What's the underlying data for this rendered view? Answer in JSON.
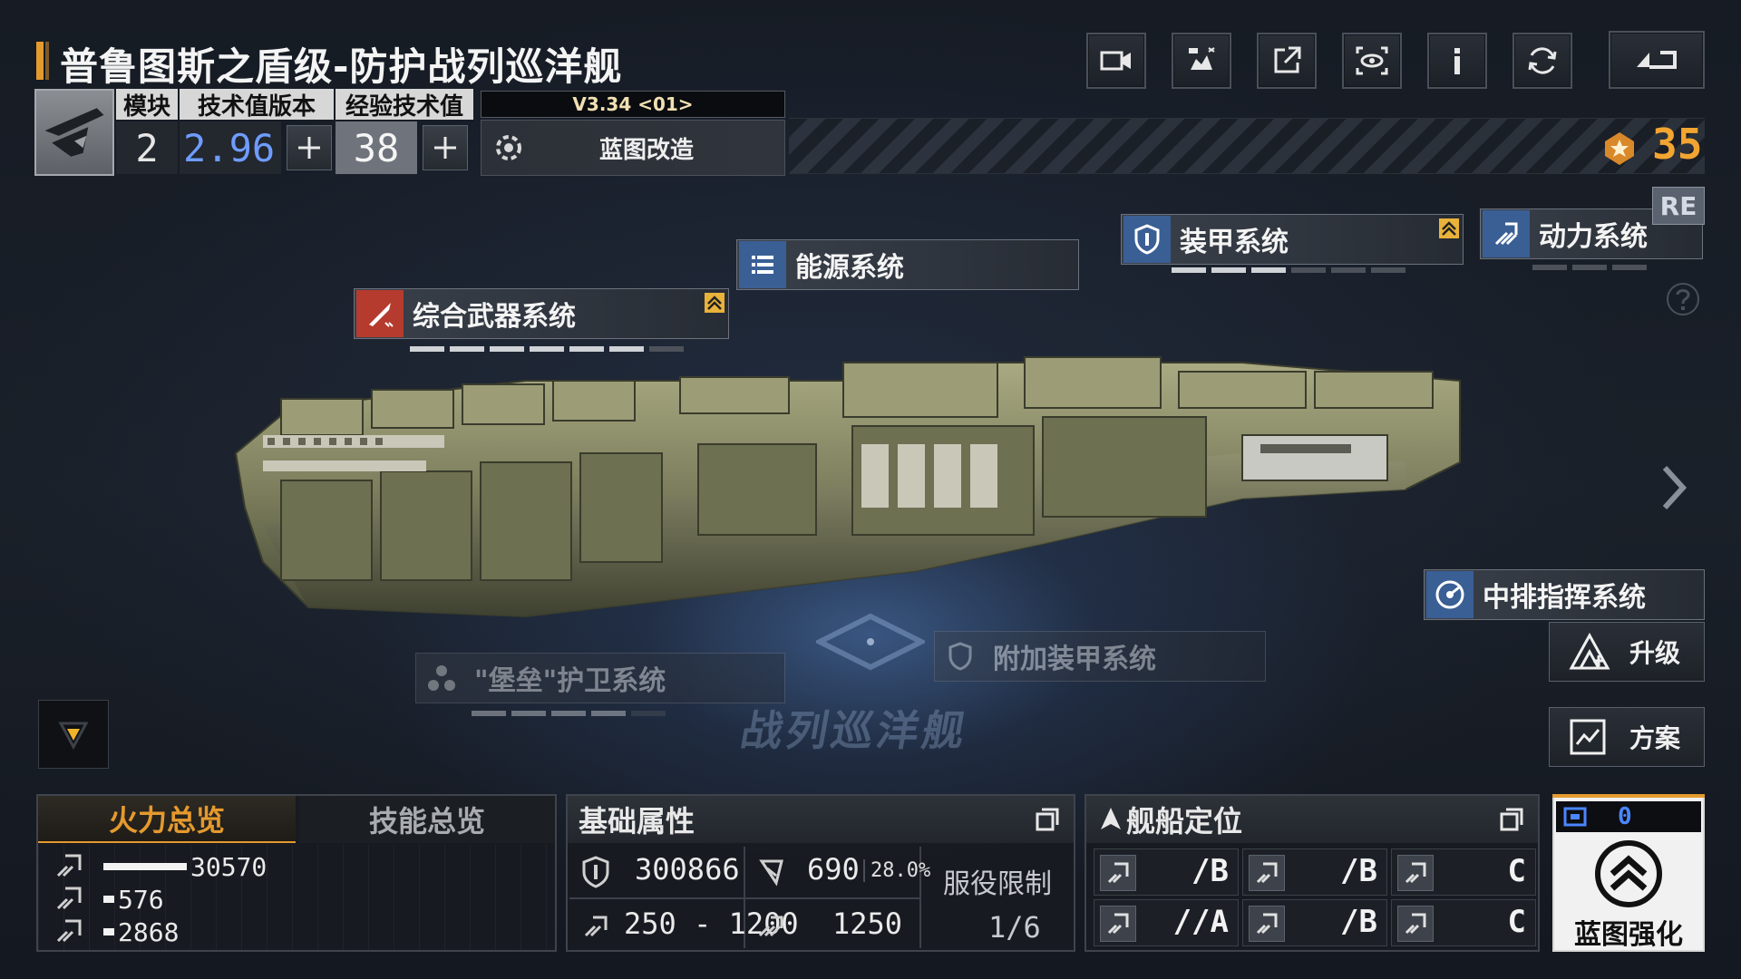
{
  "header": {
    "title": "普鲁图斯之盾级-防护战列巡洋舰",
    "toolbar": [
      "camera-icon",
      "gallery-icon",
      "share-icon",
      "view-icon",
      "info-icon",
      "refresh-icon",
      "back-icon"
    ]
  },
  "ship_info": {
    "col_module": "模块",
    "col_tech_version": "技术值版本",
    "col_exp_tech": "经验技术值",
    "module_value": "2",
    "tech_version_value": "2.96",
    "exp_tech_value": "38",
    "blueprint_version": "V3.34 <01>",
    "blueprint_modify_label": "蓝图改造"
  },
  "currency": {
    "value": "35",
    "accent": "#f2a531"
  },
  "systems": {
    "weapons": "综合武器系统",
    "energy": "能源系统",
    "armor": "装甲系统",
    "power": "动力系统",
    "command": "中排指挥系统",
    "escort": "\"堡垒\"护卫系统",
    "extra_armor": "附加装甲系统",
    "re_badge": "RE"
  },
  "ship_class_watermark": "战列巡洋舰",
  "actions": {
    "upgrade": "升级",
    "plan": "方案"
  },
  "firepower_panel": {
    "tab_active": "火力总览",
    "tab_inactive": "技能总览",
    "rows": [
      {
        "icon": "anti-ship-icon",
        "value": "30570",
        "fraction": 1.0
      },
      {
        "icon": "anti-air-icon",
        "value": "576",
        "fraction": 0.04
      },
      {
        "icon": "siege-icon",
        "value": "2868",
        "fraction": 0.04
      }
    ]
  },
  "base_attributes": {
    "title": "基础属性",
    "hp": "300866",
    "armor": "690",
    "armor_pct": "28.0%",
    "speed_range": "250 - 1200",
    "warp_speed": "1250",
    "service_limit_label": "服役限制",
    "service_limit_value": "1/6"
  },
  "positioning": {
    "title": "舰船定位",
    "cells": [
      "/B",
      "/B",
      "C",
      "//A",
      "/B",
      "C"
    ]
  },
  "blueprint_enhance": {
    "count": "0",
    "label": "蓝图强化"
  },
  "colors": {
    "accent_orange": "#e59a2e",
    "tech_blue": "#6f9cff"
  }
}
